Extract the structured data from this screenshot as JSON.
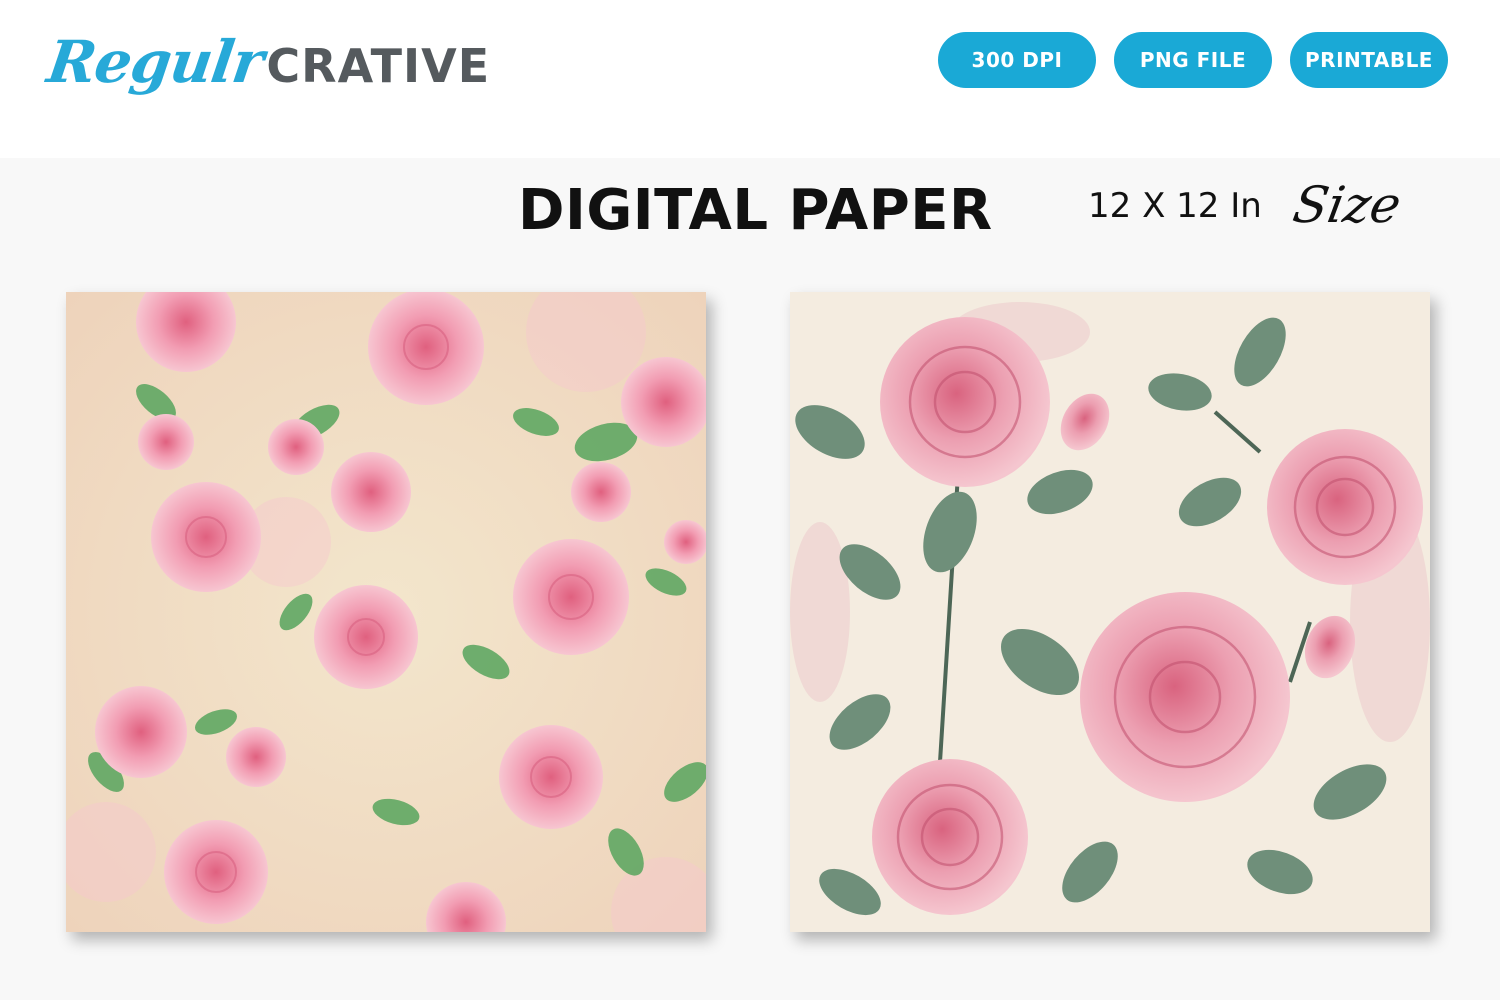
{
  "brand": {
    "script": "Regulr",
    "bold": "CRATIVE"
  },
  "badges": [
    "300 DPI",
    "PNG FILE",
    "PRINTABLE"
  ],
  "title": "DIGITAL PAPER",
  "size": {
    "text": "12 X 12 In",
    "script": "Size"
  },
  "papers": [
    {
      "name": "pink-watercolor-rose-pattern",
      "background": "#f3dcc4"
    },
    {
      "name": "vintage-pink-rose-pattern",
      "background": "#f4ece0"
    }
  ],
  "colors": {
    "accent": "#1aa9d6",
    "logo_blue": "#27a9d8",
    "logo_gray": "#555a5e",
    "rose_pink": "#e98aa4",
    "leaf_green": "#5fa863",
    "leaf_sage": "#6f8f7a"
  }
}
